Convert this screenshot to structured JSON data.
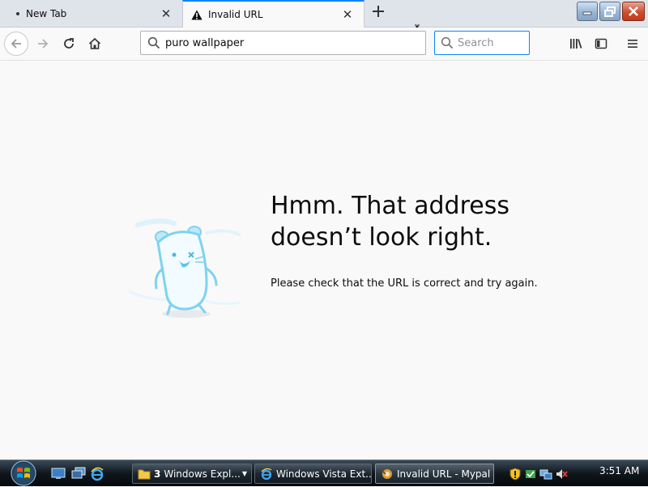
{
  "tabs": [
    {
      "label": "New Tab"
    },
    {
      "label": "Invalid URL"
    }
  ],
  "navbar": {
    "url_value": "puro wallpaper",
    "search_placeholder": "Search"
  },
  "error_page": {
    "title": "Hmm. That address doesn’t look right.",
    "description": "Please check that the URL is correct and try again."
  },
  "taskbar": {
    "items": [
      {
        "count": "3",
        "label": "Windows Expl..."
      },
      {
        "label": "Windows Vista Ext..."
      },
      {
        "label": "Invalid URL - Mypal"
      }
    ],
    "clock": "3:51 AM"
  },
  "icons": {
    "tab_status": "warning-icon",
    "tray": [
      "shield-icon",
      "security-center-icon",
      "network-icon",
      "volume-muted-icon"
    ]
  },
  "colors": {
    "accent": "#0a84ff",
    "page_background": "#f9f9fa",
    "mascot": "#7dd3f0"
  }
}
